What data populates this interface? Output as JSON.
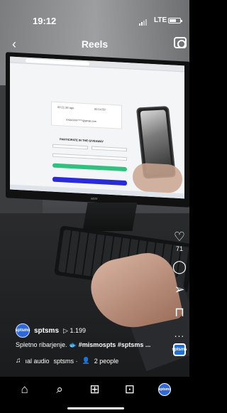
{
  "status_bar": {
    "time": "19:12",
    "network": "LTE",
    "battery_level": 0.55
  },
  "header": {
    "back_icon": "chevron-left-icon",
    "title": "Reels",
    "camera_icon": "camera-icon"
  },
  "video_screen": {
    "form_title": "PARTICIPATE IN THE GIVEAWAY",
    "stat_left": "00:21:36 ago",
    "stat_right": "00:14:59",
    "email": "XXAXXXX*****@gmail.com",
    "monitor_brand": "acer"
  },
  "actions": {
    "like_icon": "heart-icon",
    "like_count": "71",
    "comment_icon": "comment-icon",
    "share_icon": "send-icon",
    "save_icon": "bookmark-icon",
    "more_icon": "more-icon",
    "more_label": "...",
    "audio_thumb_label": "sptsms"
  },
  "post": {
    "avatar_label": "sptsms",
    "username": "sptsms",
    "views_icon": "play-icon",
    "views": "1.199",
    "caption_text": "Spletno ribarjenje.",
    "caption_emoji": "🐟",
    "caption_tags": "#mismospts #sptsms ...",
    "audio_icon": "music-note-icon",
    "audio_text": "ıal audio",
    "audio_author": "sptsms ·",
    "people_icon": "person-icon",
    "people_text": "2 people"
  },
  "bottom_nav": {
    "items": [
      {
        "icon": "home-icon",
        "glyph": "⌂"
      },
      {
        "icon": "search-icon",
        "glyph": "⌕"
      },
      {
        "icon": "create-icon",
        "glyph": "⊞"
      },
      {
        "icon": "shop-icon",
        "glyph": "⊡"
      },
      {
        "icon": "profile-avatar",
        "glyph": "sptsms"
      }
    ]
  }
}
